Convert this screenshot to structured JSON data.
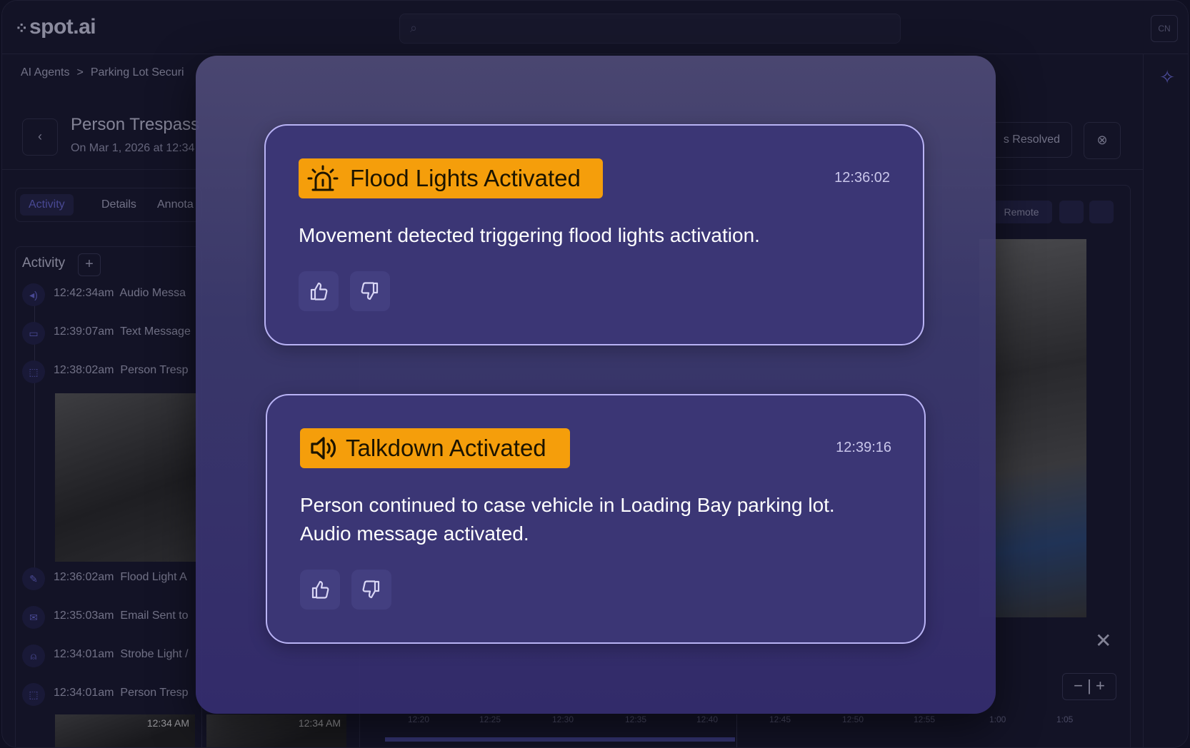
{
  "app": {
    "logo": "spot.ai",
    "user_initials": "CN"
  },
  "breadcrumb": [
    "AI Agents",
    ">",
    "Parking Lot Securi"
  ],
  "header": {
    "title": "Person Trespass",
    "subtitle": "On Mar 1, 2026 at 12:34",
    "resolved_label": "s Resolved"
  },
  "tabs": [
    "Activity",
    "Details",
    "Annota"
  ],
  "activity": {
    "title": "Activity",
    "items": [
      {
        "time": "12:42:34am",
        "text": "Audio Messa",
        "icon": "speaker-icon"
      },
      {
        "time": "12:39:07am",
        "text": "Text Message",
        "icon": "chat-icon"
      },
      {
        "time": "12:38:02am",
        "text": "Person Tresp",
        "icon": "detection-icon"
      },
      {
        "time": "12:36:02am",
        "text": "Flood Light A",
        "icon": "flood-light-icon"
      },
      {
        "time": "12:35:03am",
        "text": "Email Sent to",
        "icon": "mail-icon"
      },
      {
        "time": "12:34:01am",
        "text": "Strobe Light /",
        "icon": "alarm-icon"
      },
      {
        "time": "12:34:01am",
        "text": "Person Tresp",
        "icon": "detection-icon"
      }
    ],
    "thumb_labels": [
      "12:34 AM",
      "12:34 AM"
    ]
  },
  "video": {
    "remote_label": "Remote"
  },
  "timeline": {
    "ticks": [
      "12:20",
      "12:25",
      "12:30",
      "12:35",
      "12:40",
      "12:45",
      "12:50",
      "12:55",
      "1:00",
      "1:05"
    ]
  },
  "modal": {
    "cards": [
      {
        "badge": "Flood Lights Activated",
        "badge_icon": "alarm-light-icon",
        "time": "12:36:02",
        "description": "Movement detected triggering flood lights activation."
      },
      {
        "badge": "Talkdown Activated",
        "badge_icon": "speaker-icon",
        "time": "12:39:16",
        "description_line1": "Person continued to case vehicle in Loading Bay parking lot.",
        "description_line2": "Audio message activated."
      }
    ]
  },
  "colors": {
    "badge": "#f59e0b",
    "card_bg": "#3b3675",
    "card_border": "#b9b3f5",
    "accent": "#6b6bd8"
  }
}
